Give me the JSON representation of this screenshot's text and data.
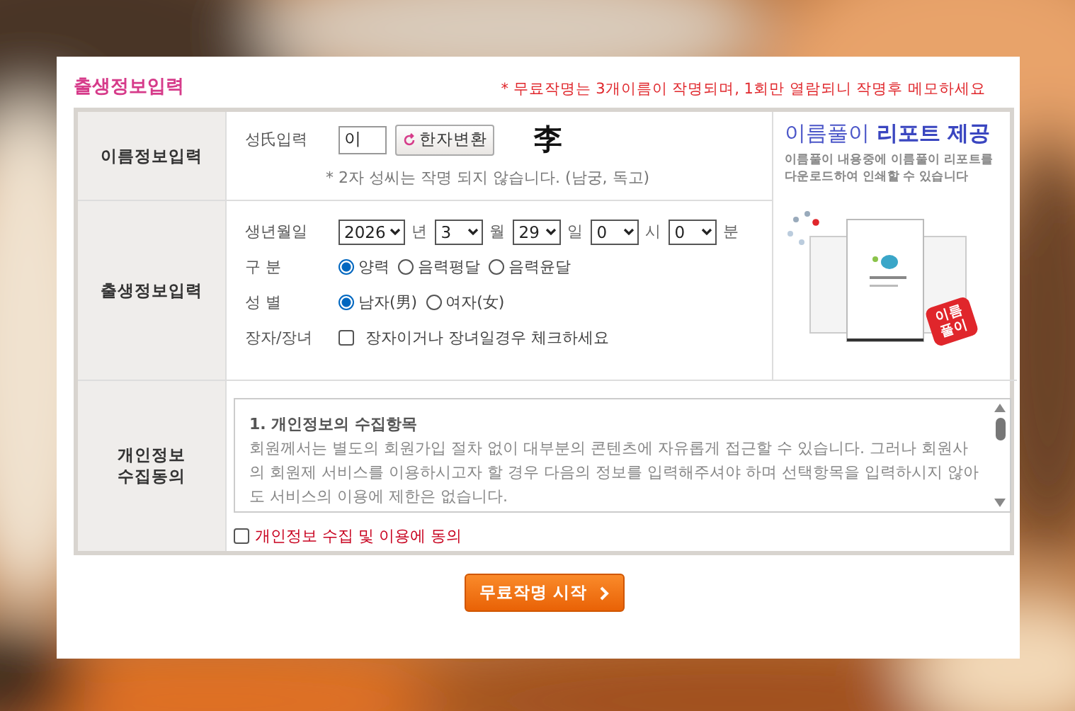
{
  "header": {
    "title": "출생정보입력",
    "notice": "* 무료작명는 3개이름이 작명되며, 1회만 열람되니 작명후 메모하세요"
  },
  "name_section": {
    "label": "이름정보입력",
    "field_label": "성氏입력",
    "surname": "이",
    "convert_button": "한자변환",
    "hanja": "李",
    "note": "* 2자 성씨는 작명 되지 않습니다. (남궁, 독고)"
  },
  "birth_section": {
    "label": "출생정보입력",
    "date_label": "생년월일",
    "date_parts": [
      {
        "value": "2026",
        "unit": "년"
      },
      {
        "value": "3",
        "unit": "월"
      },
      {
        "value": "29",
        "unit": "일"
      },
      {
        "value": "0",
        "unit": "시"
      },
      {
        "value": "0",
        "unit": "분"
      }
    ],
    "calendar": {
      "label": "구 분",
      "options": [
        {
          "label": "양력",
          "selected": true
        },
        {
          "label": "음력평달",
          "selected": false
        },
        {
          "label": "음력윤달",
          "selected": false
        }
      ]
    },
    "gender": {
      "label": "성 별",
      "options": [
        {
          "label": "남자(男)",
          "selected": true
        },
        {
          "label": "여자(女)",
          "selected": false
        }
      ]
    },
    "firstborn": {
      "label": "장자/장녀",
      "checkbox_label": "장자이거나 장녀일경우 체크하세요",
      "checked": false
    }
  },
  "promo": {
    "title": "이름풀이 **리포트 제공**",
    "text": "이름풀이 내용중에 이름풀이 리포트를 다운로드하여 인쇄할 수 있습니다",
    "badge": "이름풀이"
  },
  "consent_section": {
    "label": "개인정보 수집동의",
    "heading": "1. 개인정보의 수집항목",
    "body": "회원께서는 별도의 회원가입 절차 없이 대부분의 콘텐츠에 자유롭게 접근할 수 있습니다. 그러나 회원사의 회원제 서비스를 이용하시고자 할 경우 다음의 정보를 입력해주셔야 하며 선택항목을 입력하시지 않아도 서비스의 이용에 제한은 없습니다.",
    "checkbox_label": "개인정보 수집 및 이용에 동의",
    "checked": false
  },
  "submit_button": "무료작명 시작"
}
